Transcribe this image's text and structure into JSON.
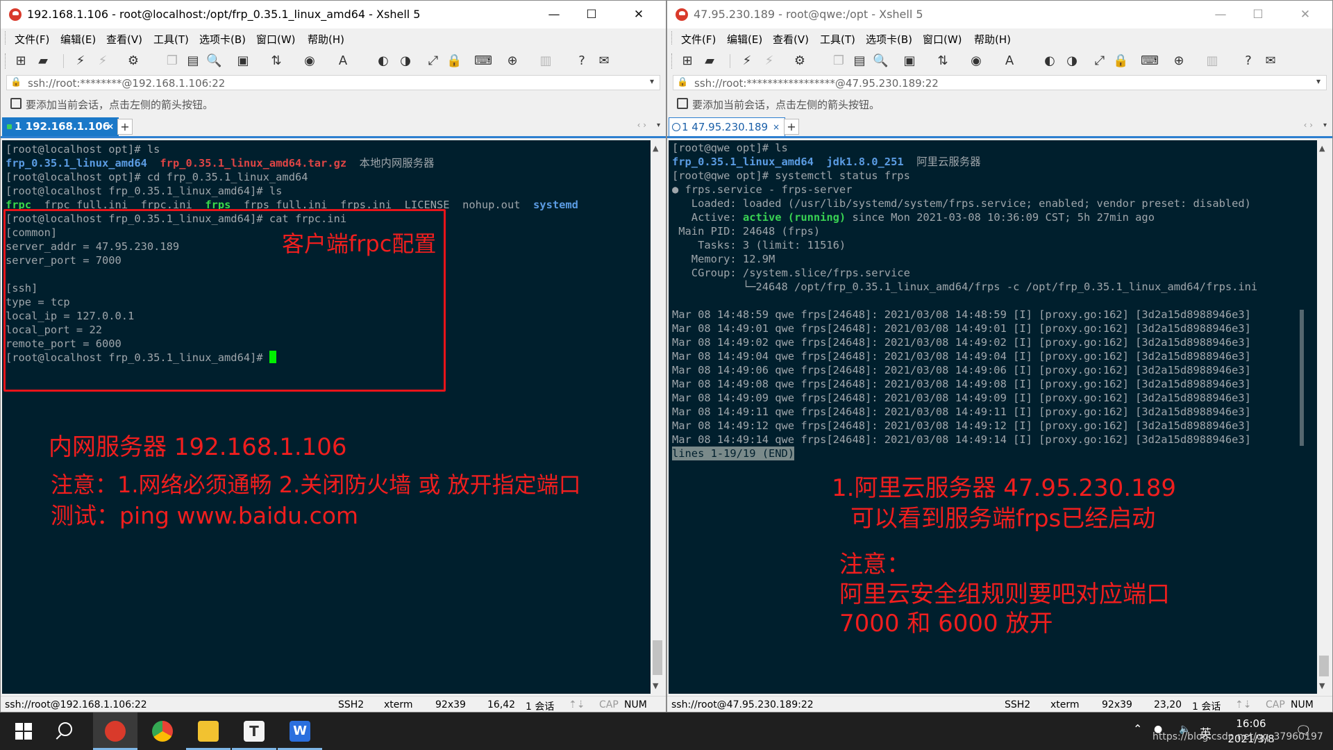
{
  "colors": {
    "terminal_bg": "#001f2d",
    "annotation_red": "#f01e1e",
    "directory_blue": "#5b9ce3",
    "archive_red": "#e04545",
    "executable_green": "#3ad84a",
    "tab_blue": "#1a78c8"
  },
  "menu": [
    "文件(F)",
    "编辑(E)",
    "查看(V)",
    "工具(T)",
    "选项卡(B)",
    "窗口(W)",
    "帮助(H)"
  ],
  "hint_text": "要添加当前会话，点击左侧的箭头按钮。",
  "window_left": {
    "title": "192.168.1.106 - root@localhost:/opt/frp_0.35.1_linux_amd64 - Xshell 5",
    "address": "ssh://root:********@192.168.1.106:22",
    "tab_label": "1 192.168.1.106",
    "terminal": {
      "l1": "[root@localhost opt]# ls",
      "l2_a": "frp_0.35.1_linux_amd64",
      "l2_b": "frp_0.35.1_linux_amd64.tar.gz",
      "l2_c": "本地内网服务器",
      "l3": "[root@localhost opt]# cd frp_0.35.1_linux_amd64",
      "l4": "[root@localhost frp_0.35.1_linux_amd64]# ls",
      "l5_a": "frpc",
      "l5_b": "frpc_full.ini",
      "l5_c": "frpc.ini",
      "l5_d": "frps",
      "l5_e": "frps_full.ini",
      "l5_f": "frps.ini",
      "l5_g": "LICENSE",
      "l5_h": "nohup.out",
      "l5_i": "systemd",
      "l6": "[root@localhost frp_0.35.1_linux_amd64]# cat frpc.ini",
      "l7": "[common]",
      "l8": "server_addr = 47.95.230.189",
      "l9": "server_port = 7000",
      "l10": "[ssh]",
      "l11": "type = tcp",
      "l12": "local_ip = 127.0.0.1",
      "l13": "local_port = 22",
      "l14": "remote_port = 6000",
      "l15": "[root@localhost frp_0.35.1_linux_amd64]# "
    },
    "annotations": {
      "box_label": "客户端frpc配置",
      "n1": "内网服务器 192.168.1.106",
      "n2": "注意：1.网络必须通畅 2.关闭防火墙 或 放开指定端口",
      "n3": "测试：ping www.baidu.com"
    },
    "status": {
      "conn": "ssh://root@192.168.1.106:22",
      "proto": "SSH2",
      "term": "xterm",
      "size": "92x39",
      "pos": "16,42",
      "sessions": "1 会话",
      "cap": "CAP",
      "num": "NUM"
    }
  },
  "window_right": {
    "title": "47.95.230.189 - root@qwe:/opt - Xshell 5",
    "address": "ssh://root:*****************@47.95.230.189:22",
    "tab_label": "1 47.95.230.189",
    "terminal": {
      "l1": "[root@qwe opt]# ls",
      "l2_a": "frp_0.35.1_linux_amd64",
      "l2_b": "jdk1.8.0_251",
      "l2_c": "阿里云服务器",
      "l3": "[root@qwe opt]# systemctl status frps",
      "l4_dot": "●",
      "l4": " frps.service - frps-server",
      "l5": "   Loaded: loaded (/usr/lib/systemd/system/frps.service; enabled; vendor preset: disabled)",
      "l6_a": "   Active: ",
      "l6_b": "active (running)",
      "l6_c": " since Mon 2021-03-08 10:36:09 CST; 5h 27min ago",
      "l7": " Main PID: 24648 (frps)",
      "l8": "    Tasks: 3 (limit: 11516)",
      "l9": "   Memory: 12.9M",
      "l10": "   CGroup: /system.slice/frps.service",
      "l11": "           └─24648 /opt/frp_0.35.1_linux_amd64/frps -c /opt/frp_0.35.1_linux_amd64/frps.ini",
      "log1": "Mar 08 14:48:59 qwe frps[24648]: 2021/03/08 14:48:59 [I] [proxy.go:162] [3d2a15d8988946e3]",
      "log2": "Mar 08 14:49:01 qwe frps[24648]: 2021/03/08 14:49:01 [I] [proxy.go:162] [3d2a15d8988946e3]",
      "log3": "Mar 08 14:49:02 qwe frps[24648]: 2021/03/08 14:49:02 [I] [proxy.go:162] [3d2a15d8988946e3]",
      "log4": "Mar 08 14:49:04 qwe frps[24648]: 2021/03/08 14:49:04 [I] [proxy.go:162] [3d2a15d8988946e3]",
      "log5": "Mar 08 14:49:06 qwe frps[24648]: 2021/03/08 14:49:06 [I] [proxy.go:162] [3d2a15d8988946e3]",
      "log6": "Mar 08 14:49:08 qwe frps[24648]: 2021/03/08 14:49:08 [I] [proxy.go:162] [3d2a15d8988946e3]",
      "log7": "Mar 08 14:49:09 qwe frps[24648]: 2021/03/08 14:49:09 [I] [proxy.go:162] [3d2a15d8988946e3]",
      "log8": "Mar 08 14:49:11 qwe frps[24648]: 2021/03/08 14:49:11 [I] [proxy.go:162] [3d2a15d8988946e3]",
      "log9": "Mar 08 14:49:12 qwe frps[24648]: 2021/03/08 14:49:12 [I] [proxy.go:162] [3d2a15d8988946e3]",
      "log10": "Mar 08 14:49:14 qwe frps[24648]: 2021/03/08 14:49:14 [I] [proxy.go:162] [3d2a15d8988946e3]",
      "pager": "lines 1-19/19 (END)"
    },
    "annotations": {
      "n1": "1.阿里云服务器 47.95.230.189",
      "n2": "可以看到服务端frps已经启动",
      "n3": "注意：",
      "n4": "阿里云安全组规则要吧对应端口",
      "n5": "7000 和 6000 放开"
    },
    "status": {
      "conn": "ssh://root@47.95.230.189:22",
      "proto": "SSH2",
      "term": "xterm",
      "size": "92x39",
      "pos": "23,20",
      "sessions": "1 会话",
      "cap": "CAP",
      "num": "NUM"
    }
  },
  "taskbar": {
    "ime": "英",
    "time": "16:06",
    "date": "2021/3/8",
    "watermark": "https://blog.csdn.net/qq_37960197"
  }
}
